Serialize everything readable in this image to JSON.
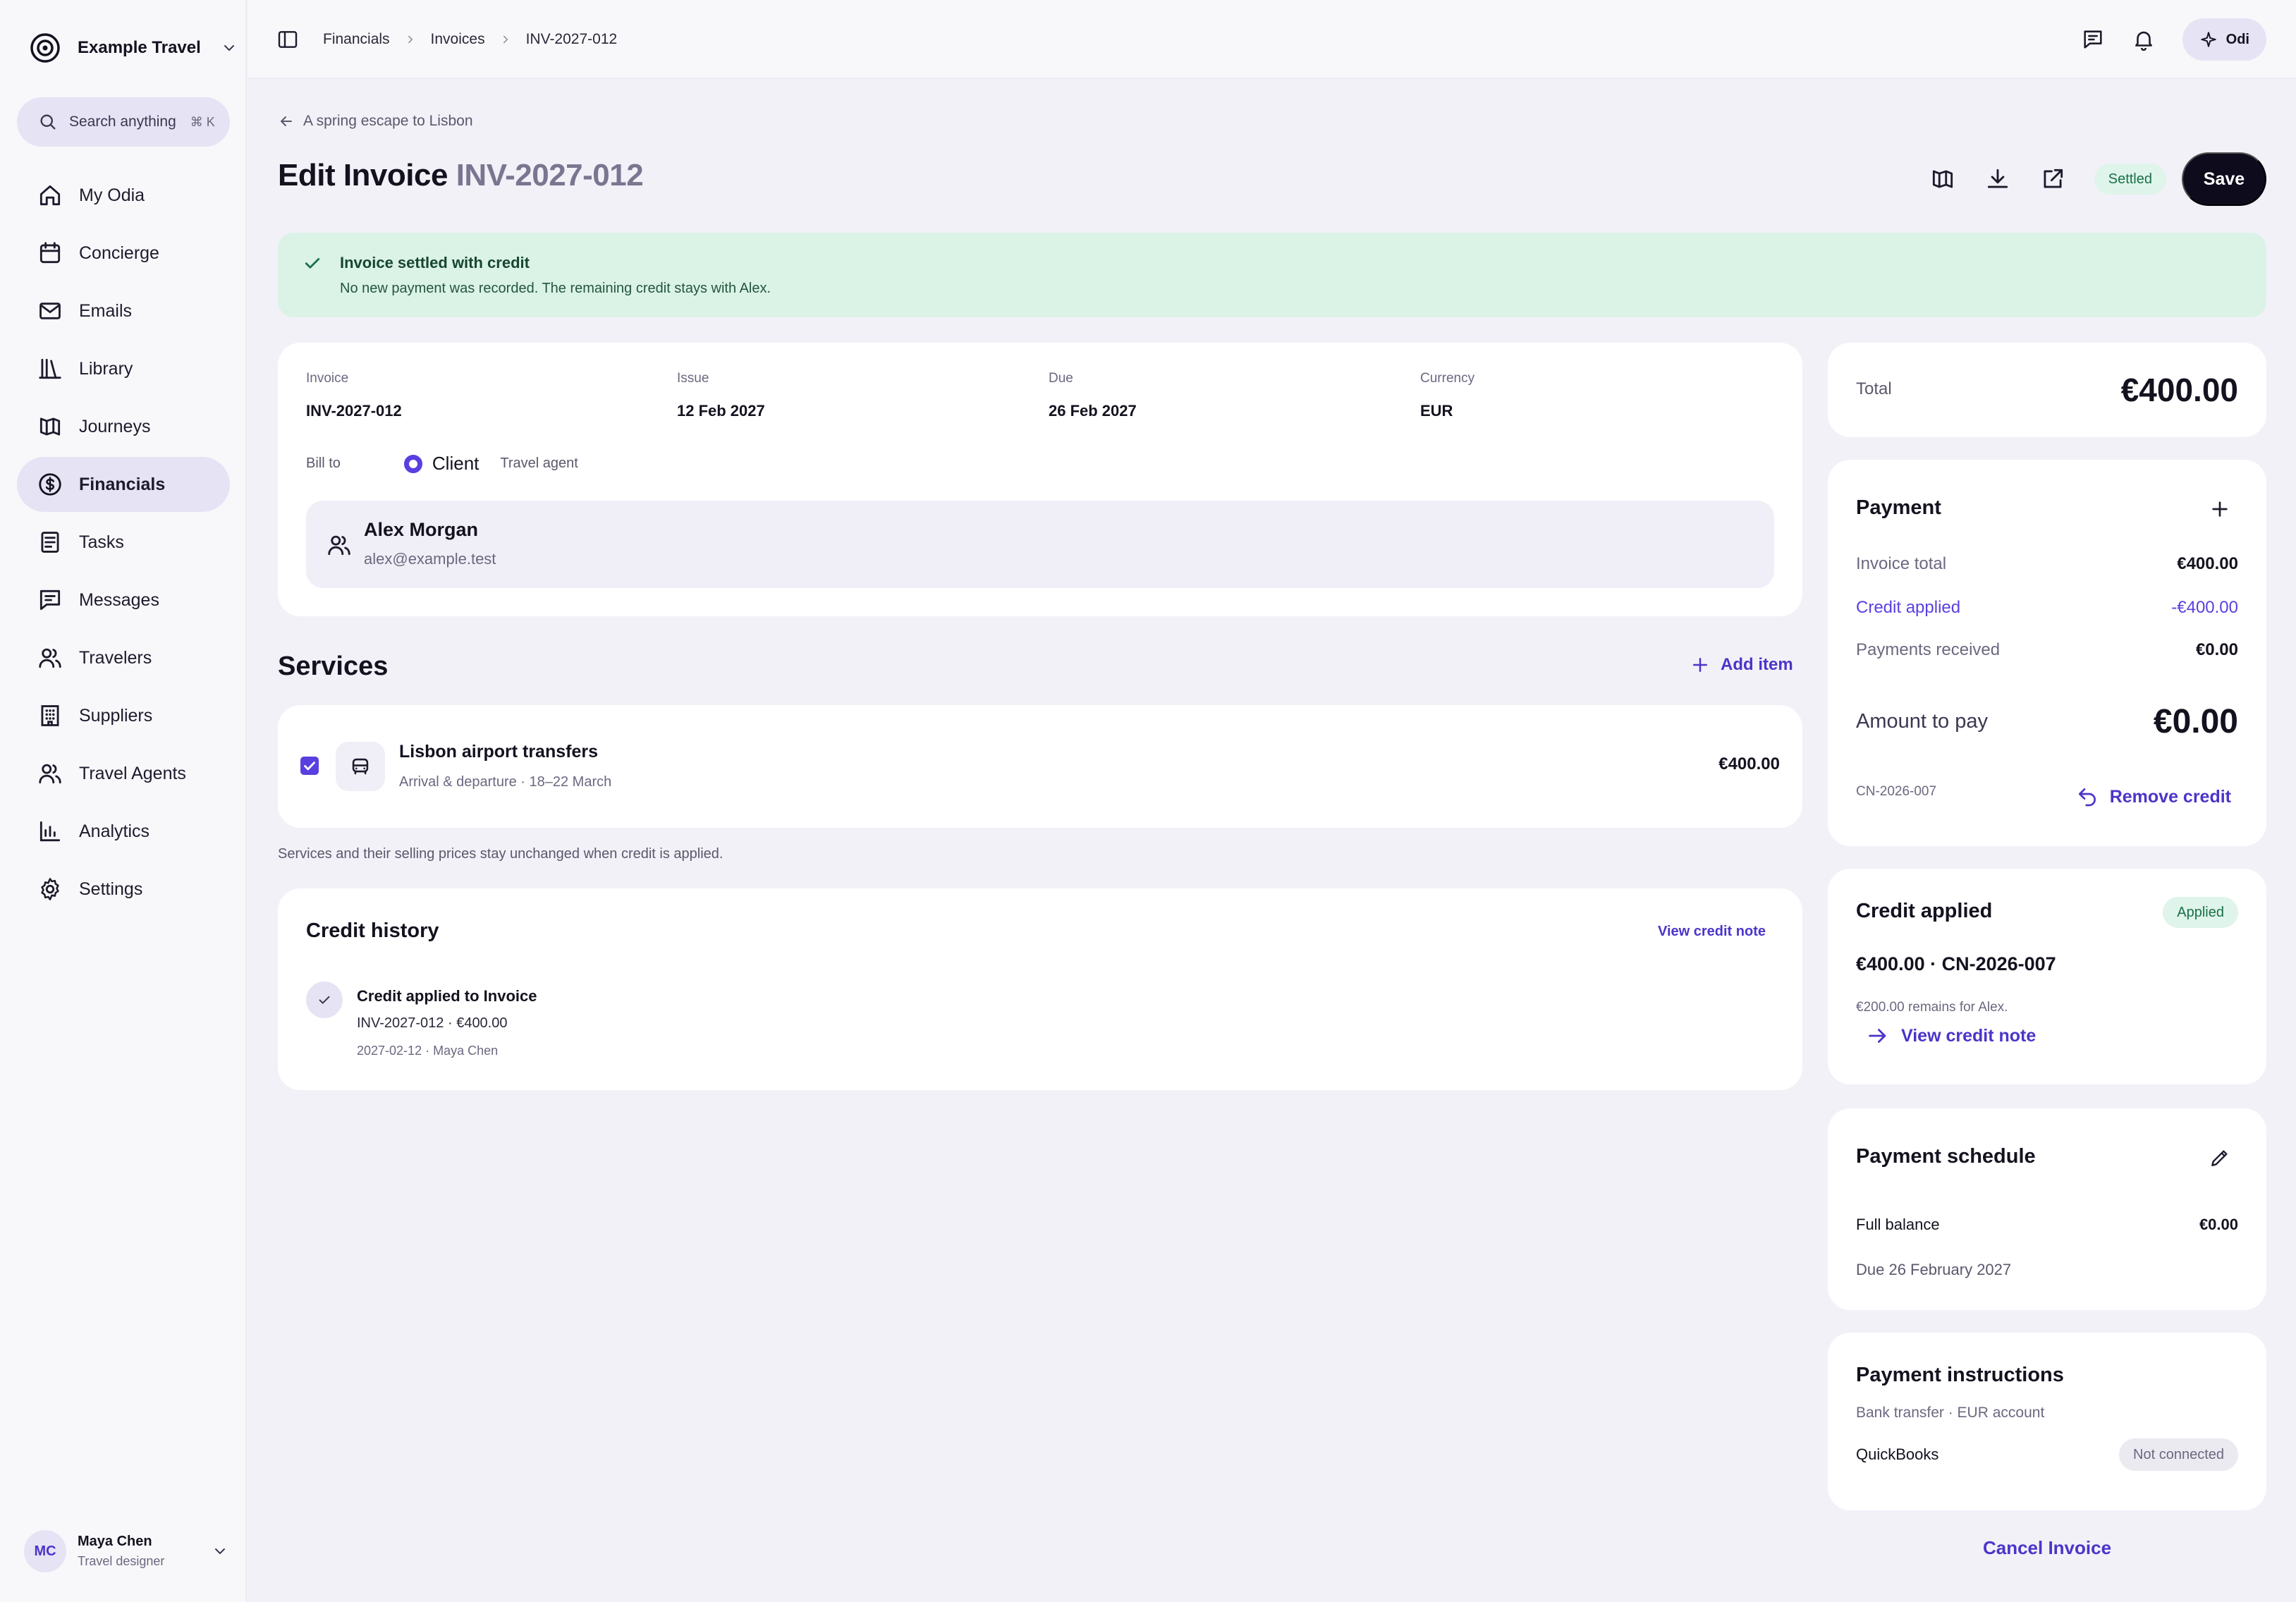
{
  "brand": {
    "name": "Example Travel"
  },
  "search": {
    "placeholder": "Search anything",
    "shortcut": "⌘ K"
  },
  "nav": [
    {
      "label": "My Odia",
      "icon": "home-icon"
    },
    {
      "label": "Concierge",
      "icon": "calendar-icon"
    },
    {
      "label": "Emails",
      "icon": "mail-icon"
    },
    {
      "label": "Library",
      "icon": "library-icon"
    },
    {
      "label": "Journeys",
      "icon": "map-icon"
    },
    {
      "label": "Financials",
      "icon": "dollar-icon",
      "active": true
    },
    {
      "label": "Tasks",
      "icon": "tasks-icon"
    },
    {
      "label": "Messages",
      "icon": "message-icon"
    },
    {
      "label": "Travelers",
      "icon": "users-icon"
    },
    {
      "label": "Suppliers",
      "icon": "building-icon"
    },
    {
      "label": "Travel Agents",
      "icon": "users-icon"
    },
    {
      "label": "Analytics",
      "icon": "chart-icon"
    },
    {
      "label": "Settings",
      "icon": "gear-icon"
    }
  ],
  "user": {
    "initials": "MC",
    "name": "Maya Chen",
    "role": "Travel designer"
  },
  "breadcrumbs": [
    "Financials",
    "Invoices",
    "INV-2027-012"
  ],
  "topbar": {
    "assistant_label": "Odi"
  },
  "back_link": "A spring escape to Lisbon",
  "title": {
    "prefix": "Edit Invoice",
    "number": "INV-2027-012"
  },
  "status_badge": "Settled",
  "save_label": "Save",
  "alert": {
    "title": "Invoice settled with credit",
    "body": "No new payment was recorded. The remaining credit stays with Alex."
  },
  "invoice_meta": [
    {
      "label": "Invoice",
      "value": "INV-2027-012"
    },
    {
      "label": "Issue",
      "value": "12 Feb 2027"
    },
    {
      "label": "Due",
      "value": "26 Feb 2027"
    },
    {
      "label": "Currency",
      "value": "EUR"
    }
  ],
  "bill_to": {
    "label": "Bill to",
    "selected": "Client",
    "other": "Travel agent"
  },
  "client": {
    "name": "Alex Morgan",
    "email": "alex@example.test"
  },
  "services": {
    "heading": "Services",
    "add_label": "Add item",
    "items": [
      {
        "name": "Lisbon airport transfers",
        "detail": "Arrival & departure · 18–22 March",
        "price": "€400.00",
        "checked": true
      }
    ],
    "note": "Services and their selling prices stay unchanged when credit is applied."
  },
  "credit_history": {
    "heading": "Credit history",
    "link": "View credit note",
    "entries": [
      {
        "title": "Credit applied to Invoice",
        "detail": "INV-2027-012 · €400.00",
        "meta": "2027-02-12 · Maya Chen"
      }
    ]
  },
  "total": {
    "label": "Total",
    "value": "€400.00"
  },
  "payment": {
    "heading": "Payment",
    "rows": [
      {
        "label": "Invoice total",
        "value": "€400.00"
      },
      {
        "label": "Credit applied",
        "value": "-€400.00"
      },
      {
        "label": "Payments received",
        "value": "€0.00"
      }
    ],
    "amount_label": "Amount to pay",
    "amount_value": "€0.00",
    "credit_ref": "CN-2026-007",
    "remove_label": "Remove credit"
  },
  "credit_applied": {
    "heading": "Credit applied",
    "badge": "Applied",
    "amount": "€400.00 · CN-2026-007",
    "remaining": "€200.00 remains for Alex.",
    "link": "View credit note"
  },
  "schedule": {
    "heading": "Payment schedule",
    "row_label": "Full balance",
    "row_value": "€0.00",
    "due": "Due 26 February 2027"
  },
  "instructions": {
    "heading": "Payment instructions",
    "method": "Bank transfer · EUR account",
    "integration": "QuickBooks",
    "integration_status": "Not connected"
  },
  "cancel_label": "Cancel Invoice",
  "colors": {
    "accent": "#5a3fe0",
    "success_bg": "#dbf3e7",
    "primary_button": "#0d0b1c"
  }
}
